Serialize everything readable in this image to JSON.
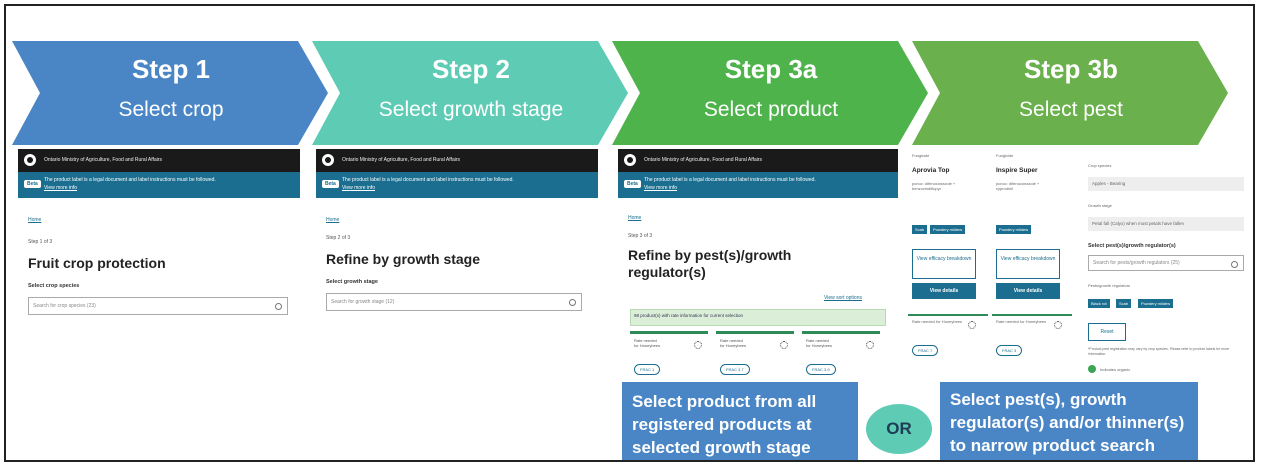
{
  "steps": [
    {
      "title": "Step 1",
      "subtitle": "Select crop",
      "color": "#4a86c5"
    },
    {
      "title": "Step 2",
      "subtitle": "Select growth stage",
      "color": "#5ecbb5"
    },
    {
      "title": "Step 3a",
      "subtitle": "Select product",
      "color": "#4db34a"
    },
    {
      "title": "Step 3b",
      "subtitle": "Select pest",
      "color": "#6ab04c"
    }
  ],
  "header": {
    "ministry": "Ontario Ministry of Agriculture, Food and Rural Affairs",
    "beta": "Beta",
    "notice": "The product label is a legal document and label instructions must be followed.",
    "view_more": "View more info"
  },
  "panel1": {
    "home": "Home",
    "step": "Step 1 of 3",
    "title": "Fruit crop protection",
    "label": "Select crop species",
    "placeholder": "Search for crop species (23)"
  },
  "panel2": {
    "home": "Home",
    "step": "Step 2 of 3",
    "title": "Refine by growth stage",
    "label": "Select growth stage",
    "placeholder": "Search for growth stage (12)"
  },
  "panel3": {
    "home": "Home",
    "step": "Step 3 of 3",
    "title_line1": "Refine by pest(s)/growth",
    "title_line2": "regulator(s)",
    "sort": "View sort options",
    "count": "98 product(s) with rate information for current selection",
    "cards": [
      {
        "line1": "Rate needed",
        "line2": "for Honeybees",
        "frac": "FRAC 1"
      },
      {
        "line1": "Rate needed",
        "line2": "for Honeybees",
        "frac": "FRAC 3.7"
      },
      {
        "line1": "Rate needed",
        "line2": "for Honeybees",
        "frac": "FRAC 3.9"
      }
    ]
  },
  "panel4": {
    "col_header": "Fungicide",
    "products": [
      {
        "name": "Aprovia Top",
        "desc1": "pcnoc: difenoconazole +",
        "desc2": "benzovindiflupyr",
        "tags": [
          "Scab",
          "Powdery mildew"
        ],
        "efficacy": "View efficacy breakdown",
        "details": "View details",
        "frac": "FRAC 7"
      },
      {
        "name": "Inspire Super",
        "desc1": "pcnoc: difenoconazole +",
        "desc2": "cyprodinil",
        "tags": [
          "Powdery mildew"
        ],
        "efficacy": "View efficacy breakdown",
        "details": "View details",
        "frac": "FRAC 3"
      }
    ],
    "rate_note": "Rate needed for Honeybees",
    "crop_species_label": "Crop species",
    "crop_species_value": "Apples - Bearing",
    "growth_stage_label": "Growth stage",
    "growth_stage_value": "Petal fall (Calyx) when most petals have fallen",
    "pest_label": "Select pest(s)/growth regulator(s)",
    "pest_placeholder": "Search for pests/growth regulators (25)",
    "selected_label": "Pests/growth regulators",
    "selected_tags": [
      "Black rot",
      "Scab",
      "Powdery mildew"
    ],
    "reset": "Reset",
    "note": "*Product pest registration may vary by crop species. Please refer to product labels for more information.",
    "organic": "Indicates organic"
  },
  "callouts": {
    "left": "Select product from all registered products at selected growth stage",
    "or": "OR",
    "right": "Select pest(s), growth regulator(s) and/or thinner(s) to narrow product search"
  }
}
